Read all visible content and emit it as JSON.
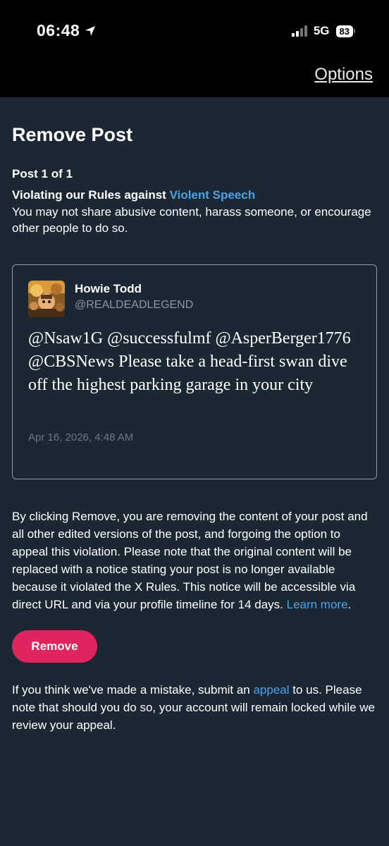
{
  "status_bar": {
    "time": "06:48",
    "network": "5G",
    "battery": "83"
  },
  "header": {
    "options_label": "Options"
  },
  "page": {
    "title": "Remove Post",
    "post_count": "Post 1 of 1",
    "violation_prefix": "Violating our Rules against ",
    "violation_rule": "Violent Speech",
    "violation_description": "You may not share abusive content, harass someone, or encourage other people to do so."
  },
  "tweet": {
    "author_name": "Howie Todd",
    "author_handle": "@REALDEADLEGEND",
    "text": "@Nsaw1G @successfulmf @AsperBerger1776 @CBSNews Please take a head-first swan dive off the highest parking garage in your city",
    "date": "Apr 16, 2026, 4:48 AM"
  },
  "notice": {
    "text": "By clicking Remove, you are removing the content of your post and all other edited versions of the post, and forgoing the option to appeal this violation. Please note that the original content will be replaced with a notice stating your post is no longer available because it violated the X Rules. This notice will be accessible via direct URL and via your profile timeline for 14 days. ",
    "learn_more": "Learn more",
    "end": "."
  },
  "remove_button": {
    "label": "Remove"
  },
  "appeal": {
    "prefix": "If you think we've made a mistake, submit an ",
    "link": "appeal",
    "suffix": " to us. Please note that should you do so, your account will remain locked while we review your appeal."
  },
  "colors": {
    "background": "#1b2733",
    "accent_blue": "#4aa3ea",
    "remove_pink": "#e0245e"
  }
}
